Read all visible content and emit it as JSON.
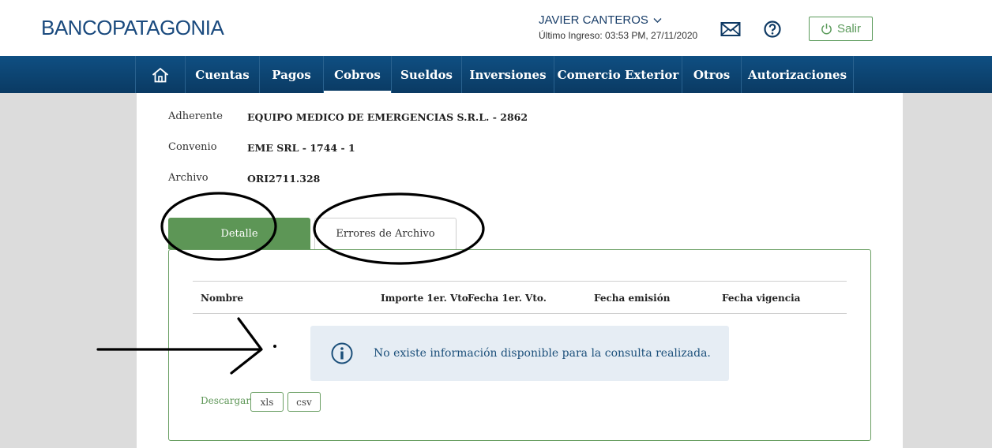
{
  "header": {
    "logo": "BANCOPATAGONIA",
    "user_name": "JAVIER CANTEROS",
    "last_login": "Último Ingreso: 03:53 PM, 27/11/2020",
    "logout_label": "Salir"
  },
  "nav": {
    "items": [
      {
        "label": "Cuentas"
      },
      {
        "label": "Pagos"
      },
      {
        "label": "Cobros"
      },
      {
        "label": "Sueldos"
      },
      {
        "label": "Inversiones"
      },
      {
        "label": "Comercio Exterior"
      },
      {
        "label": "Otros"
      },
      {
        "label": "Autorizaciones"
      }
    ],
    "active": "Cobros"
  },
  "details": {
    "adherente_label": "Adherente",
    "adherente_value": "EQUIPO MEDICO DE EMERGENCIAS S.R.L. - 2862",
    "convenio_label": "Convenio",
    "convenio_value": "EME SRL - 1744 - 1",
    "archivo_label": "Archivo",
    "archivo_value": "ORI2711.328"
  },
  "tabs": {
    "detalle": "Detalle",
    "errores": "Errores de Archivo"
  },
  "table": {
    "columns": [
      "Nombre",
      "Importe 1er. Vto",
      "Fecha 1er. Vto.",
      "Fecha emisión",
      "Fecha vigencia"
    ]
  },
  "info_message": "No existe información disponible para la consulta realizada.",
  "download": {
    "label": "Descargar",
    "xls": "xls",
    "csv": "csv"
  },
  "colors": {
    "brand_blue": "#0f4f82",
    "accent_green": "#5d9656"
  }
}
